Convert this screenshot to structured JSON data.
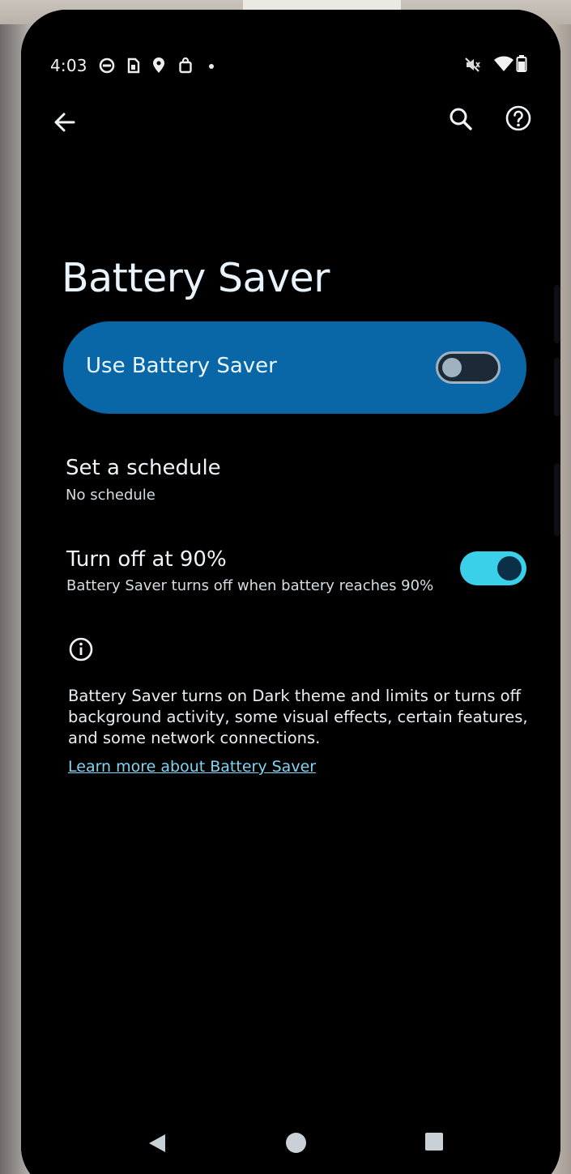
{
  "status_bar": {
    "time": "4:03",
    "left_icons": [
      "chat-bubble-icon",
      "sim-card-icon",
      "location-pin-icon",
      "shopping-bag-icon"
    ],
    "right_icons": [
      "mute-icon",
      "wifi-icon",
      "battery-icon"
    ]
  },
  "top_bar": {
    "back_icon": "back-arrow-icon",
    "search_icon": "search-icon",
    "help_icon": "help-icon"
  },
  "page": {
    "title": "Battery Saver"
  },
  "main_toggle": {
    "label": "Use Battery Saver",
    "checked": false
  },
  "settings": [
    {
      "title": "Set a schedule",
      "subtitle": "No schedule"
    },
    {
      "title": "Turn off at 90%",
      "subtitle": "Battery Saver turns off when battery reaches 90%",
      "checked": true
    }
  ],
  "info": {
    "icon": "info-icon",
    "text": "Battery Saver turns on Dark theme and limits or turns off background activity, some visual effects, certain features, and some network connections.",
    "link": "Learn more about Battery Saver"
  },
  "nav_bar": {
    "icons": [
      "nav-back-icon",
      "nav-home-icon",
      "nav-recents-icon"
    ]
  },
  "colors": {
    "accent_card": "#0a67a7",
    "toggle_on": "#3bd0ea",
    "link": "#7fd6f4",
    "background": "#000000"
  }
}
